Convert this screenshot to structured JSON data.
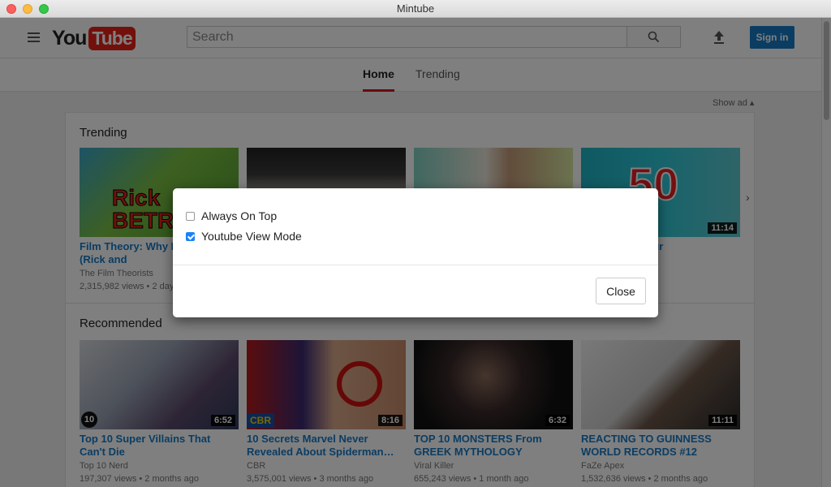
{
  "window": {
    "title": "Mintube"
  },
  "header": {
    "logo_you": "You",
    "logo_tube": "Tube",
    "search_placeholder": "Search",
    "signin_label": "Sign in"
  },
  "tabs": [
    {
      "label": "Home",
      "active": true
    },
    {
      "label": "Trending",
      "active": false
    }
  ],
  "show_ad_label": "Show ad",
  "trending": {
    "title": "Trending",
    "videos": [
      {
        "title": "Film Theory: Why M KILL Rick! (Rick and",
        "channel": "The Film Theorists",
        "views": "2,315,982 views",
        "age": "2 day",
        "thumb_text": "Rick BETRAY",
        "duration": ""
      },
      {
        "title": "",
        "channel": "",
        "views": "",
        "age": "",
        "thumb_text": "",
        "duration": ""
      },
      {
        "title": "",
        "channel": "",
        "views": "",
        "age": "",
        "thumb_text": "",
        "duration": ""
      },
      {
        "title": "cts to Blow Your",
        "channel": "",
        "views": "",
        "age": "hours ago",
        "thumb_text": "50",
        "duration": "11:14"
      }
    ]
  },
  "recommended": {
    "title": "Recommended",
    "videos": [
      {
        "title": "Top 10 Super Villains That Can't Die",
        "channel": "Top 10 Nerd",
        "views": "197,307 views",
        "age": "2 months ago",
        "duration": "6:52",
        "badge": "10"
      },
      {
        "title": "10 Secrets Marvel Never Revealed About Spiderman…",
        "channel": "CBR",
        "views": "3,575,001 views",
        "age": "3 months ago",
        "duration": "8:16",
        "badge": "CBR"
      },
      {
        "title": "TOP 10 MONSTERS From GREEK MYTHOLOGY",
        "channel": "Viral Killer",
        "views": "655,243 views",
        "age": "1 month ago",
        "duration": "6:32",
        "badge": ""
      },
      {
        "title": "REACTING TO GUINNESS WORLD RECORDS #12",
        "channel": "FaZe Apex",
        "views": "1,532,636 views",
        "age": "2 months ago",
        "duration": "11:11",
        "badge": ""
      }
    ]
  },
  "dialog": {
    "options": [
      {
        "label": "Always On Top",
        "checked": false
      },
      {
        "label": "Youtube View Mode",
        "checked": true
      }
    ],
    "close_label": "Close"
  },
  "colors": {
    "brand_red": "#e62117",
    "link_blue": "#167ac6",
    "signin_blue": "#167ac6",
    "checkbox_blue": "#1a82fb"
  }
}
